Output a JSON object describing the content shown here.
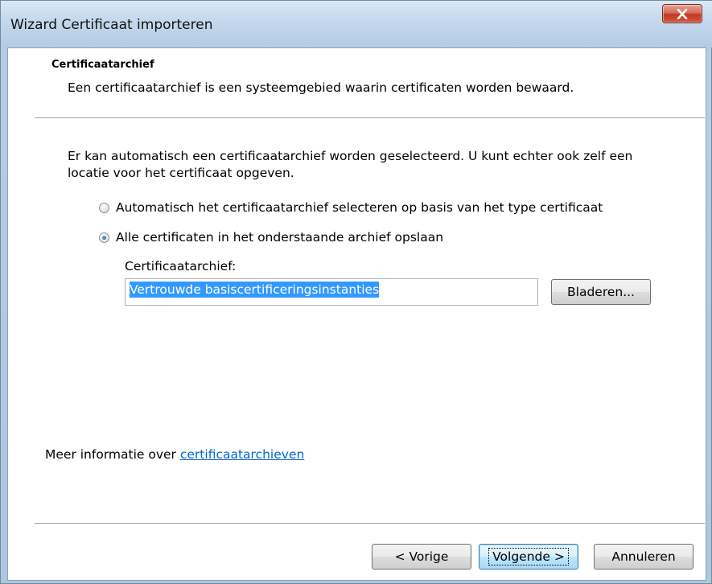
{
  "window": {
    "title": "Wizard Certificaat importeren"
  },
  "header": {
    "title": "Certificaatarchief",
    "subtitle": "Een certificaatarchief is een systeemgebied waarin certificaten worden bewaard."
  },
  "body": {
    "description": "Er kan automatisch een certificaatarchief worden geselecteerd. U kunt echter ook zelf een locatie voor het certificaat opgeven.",
    "options": [
      {
        "label": "Automatisch het certificaatarchief selecteren op basis van het type certificaat",
        "checked": false
      },
      {
        "label": "Alle certificaten in het onderstaande archief opslaan",
        "checked": true
      }
    ],
    "store_label": "Certificaatarchief:",
    "store_value": "Vertrouwde basiscertificeringsinstanties",
    "browse_label": "Bladeren...",
    "more_info_prefix": "Meer informatie over",
    "more_info_link": "certificaatarchieven"
  },
  "footer": {
    "back_label": "< Vorige",
    "next_label": "Volgende >",
    "cancel_label": "Annuleren"
  }
}
